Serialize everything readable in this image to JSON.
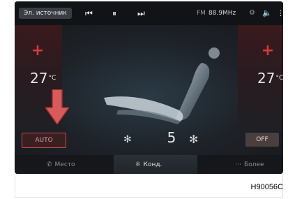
{
  "topbar": {
    "source_label": "Эл. источник",
    "prev_icon": "skip-previous-icon",
    "pause_icon": "pause-icon",
    "next_icon": "skip-next-icon",
    "radio_band": "FM",
    "radio_freq": "88.9MHz"
  },
  "climate": {
    "left_temp": "27",
    "right_temp": "27",
    "temp_unit": "°C",
    "auto_label": "AUTO",
    "off_label": "OFF",
    "fan_level": "5"
  },
  "bottom_nav": [
    {
      "label": "Место",
      "icon": "phone-icon"
    },
    {
      "label": "Конд.",
      "icon": "fan-icon"
    },
    {
      "label": "Более",
      "icon": "more-icon"
    }
  ],
  "caption": "H90056C",
  "colors": {
    "accent_red": "#d83a3a",
    "arrow": "#d95a5a"
  }
}
